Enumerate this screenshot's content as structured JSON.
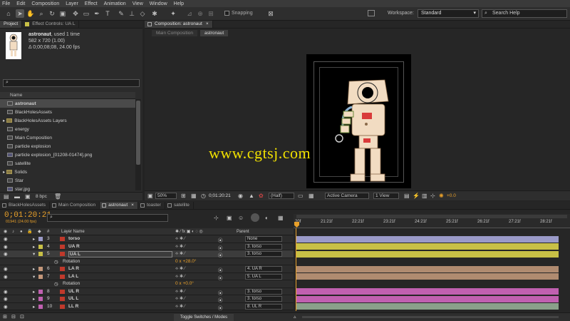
{
  "menu": [
    "File",
    "Edit",
    "Composition",
    "Layer",
    "Effect",
    "Animation",
    "View",
    "Window",
    "Help"
  ],
  "toolbar": {
    "snapping": "Snapping",
    "workspace_label": "Workspace:",
    "workspace_value": "Standard",
    "search_placeholder": "Search Help"
  },
  "project_panel": {
    "tabs": [
      "Project",
      "Effect Controls: UA L"
    ],
    "item_name": "astronaut",
    "item_used": ", used 1 time",
    "item_dims": "582 x 720 (1.00)",
    "item_duration": "Δ 0;00;08;08, 24.00 fps",
    "column_name": "Name",
    "items": [
      "astronaut",
      "BlackHolesAssets",
      "BlackHolesAssets Layers",
      "energy",
      "Main Composition",
      "particle explosion",
      "particle explosion_[01208-01474].png",
      "satellite",
      "Solids",
      "Star",
      "star.jpg"
    ],
    "bpc": "8 bpc"
  },
  "comp_panel": {
    "tab": "Composition: astronaut",
    "breadcrumbs": [
      "Main Composition",
      "astronaut"
    ],
    "zoom": "50%",
    "timecode": "0;01:20:21",
    "resolution": "(Half)",
    "camera": "Active Camera",
    "views": "1 View",
    "offset": "+0.0",
    "watermark": "www.cgtsj.com"
  },
  "timeline": {
    "tabs": [
      "BlackHolesAssets",
      "Main Composition",
      "astronaut",
      "toaster",
      "satellite"
    ],
    "timecode": "0;01:20:21",
    "fps_info": "01941 (24.00 fps)",
    "col_name": "Layer Name",
    "col_parent": "Parent",
    "toggle_label": "Toggle Switches / Modes",
    "ruler": [
      "20f",
      "21:21f",
      "22:21f",
      "23:21f",
      "24:21f",
      "25:21f",
      "26:21f",
      "27:21f",
      "28:21f"
    ],
    "layers": [
      {
        "num": "3",
        "name": "torso",
        "parent": "None",
        "color": "#9a9ac8",
        "bar": "#9a9ac8"
      },
      {
        "num": "4",
        "name": "UA R",
        "parent": "3. torso",
        "color": "#c8c046",
        "bar": "#c8c046"
      },
      {
        "num": "5",
        "name": "UA L",
        "parent": "3. torso",
        "color": "#c8c046",
        "bar": "#c8c046"
      },
      {
        "num": "",
        "name": "Rotation",
        "value": "0 x +28.0°",
        "parent": ""
      },
      {
        "num": "6",
        "name": "LA R",
        "parent": "4. UA R",
        "color": "#c4977a",
        "bar": "#b08b70"
      },
      {
        "num": "7",
        "name": "LA L",
        "parent": "5. UA L",
        "color": "#c4977a",
        "bar": "#b08b70"
      },
      {
        "num": "",
        "name": "Rotation",
        "value": "0 x +0.0°",
        "parent": ""
      },
      {
        "num": "8",
        "name": "UL R",
        "parent": "3. torso",
        "color": "#c060b0",
        "bar": "#c060b0"
      },
      {
        "num": "9",
        "name": "UL L",
        "parent": "3. torso",
        "color": "#c060b0",
        "bar": "#c060b0"
      },
      {
        "num": "10",
        "name": "LL R",
        "parent": "8. UL R",
        "color": "#c060b0",
        "bar": "#8aa08a"
      }
    ]
  },
  "colors": {
    "accent": "#e8a02a",
    "watermark": "#f0e000",
    "astronaut_body": "#f2dcc2",
    "astronaut_outline": "#8a6a4a"
  }
}
